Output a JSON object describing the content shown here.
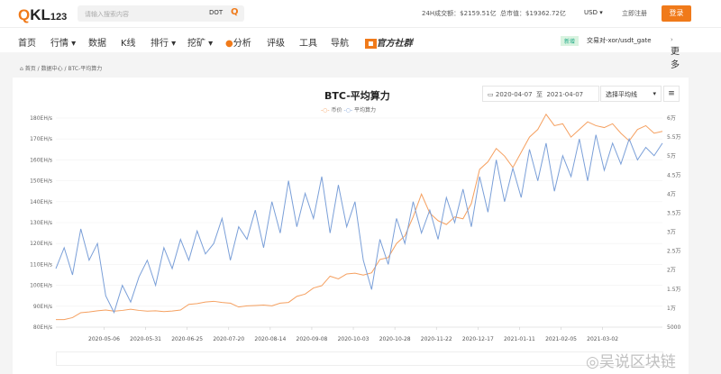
{
  "header": {
    "logo": "QKL123",
    "search_placeholder": "请输入搜索内容",
    "search_tag": "DOT",
    "volume_24h": "24H成交额：$2159.51亿",
    "market_cap": "总市值：$19362.72亿",
    "currency": "USD",
    "register": "立即注册",
    "login": "登录"
  },
  "nav": {
    "items": [
      "首页",
      "行情",
      "数据",
      "K线",
      "排行",
      "挖矿",
      "分析",
      "评级",
      "工具",
      "导航",
      "官方社群"
    ],
    "new_tag": "新增",
    "new_pair": "交易对-xor/usdt_gate",
    "more": "更多"
  },
  "breadcrumb": [
    "首页",
    "数据中心",
    "BTC-平均算力"
  ],
  "controls": {
    "date_from": "2020-04-07",
    "date_sep": "至",
    "date_to": "2021-04-07",
    "ma_select": "选择平均线"
  },
  "watermark": "吴说区块链",
  "chart_data": {
    "type": "line",
    "title": "BTC-平均算力",
    "legend": [
      "币价",
      "平均算力"
    ],
    "colors": {
      "price": "#f5a060",
      "hashrate": "#7a9fd8"
    },
    "x_ticks": [
      "2020-05-06",
      "2020-05-31",
      "2020-06-25",
      "2020-07-20",
      "2020-08-14",
      "2020-09-08",
      "2020-10-03",
      "2020-10-28",
      "2020-11-22",
      "2020-12-17",
      "2021-01-11",
      "2021-02-05",
      "2021-03-02"
    ],
    "x_range": [
      "2020-04-07",
      "2021-04-07"
    ],
    "y_left": {
      "ticks": [
        "80EH/s",
        "90EH/s",
        "100EH/s",
        "110EH/s",
        "120EH/s",
        "130EH/s",
        "140EH/s",
        "150EH/s",
        "160EH/s",
        "170EH/s",
        "180EH/s"
      ],
      "range": [
        80,
        180
      ]
    },
    "y_right": {
      "ticks": [
        "5000",
        "1万",
        "1.5万",
        "2万",
        "2.5万",
        "3万",
        "3.5万",
        "4万",
        "4.5万",
        "5万",
        "5.5万",
        "6万"
      ],
      "range": [
        5000,
        60000
      ]
    },
    "hashrate_every_5_days": [
      108,
      118,
      105,
      127,
      112,
      120,
      95,
      87,
      100,
      92,
      104,
      112,
      100,
      118,
      108,
      122,
      112,
      126,
      115,
      120,
      132,
      112,
      128,
      122,
      136,
      118,
      140,
      125,
      150,
      128,
      144,
      132,
      152,
      125,
      148,
      128,
      140,
      112,
      98,
      122,
      110,
      132,
      120,
      140,
      125,
      136,
      122,
      142,
      130,
      146,
      128,
      152,
      135,
      160,
      140,
      156,
      142,
      165,
      150,
      168,
      145,
      162,
      152,
      170,
      150,
      172,
      155,
      168,
      158,
      170,
      160,
      166,
      162,
      168
    ],
    "price_every_5_days": [
      7000,
      7000,
      7500,
      8800,
      9000,
      9300,
      9500,
      9200,
      9400,
      9700,
      9400,
      9200,
      9300,
      9100,
      9250,
      9500,
      11000,
      11200,
      11600,
      11800,
      11500,
      11300,
      10300,
      10600,
      10700,
      10800,
      10600,
      11300,
      11500,
      13100,
      13700,
      15300,
      15900,
      18400,
      17700,
      19000,
      19200,
      18700,
      19300,
      22800,
      23300,
      27000,
      29000,
      34000,
      40000,
      35000,
      33000,
      32000,
      34000,
      33500,
      37500,
      46500,
      48500,
      52000,
      50000,
      47000,
      51000,
      55000,
      57000,
      61000,
      58000,
      58500,
      55000,
      57000,
      59000,
      58000,
      57500,
      58500,
      56000,
      54000,
      57000,
      58000,
      56000,
      56500
    ]
  }
}
